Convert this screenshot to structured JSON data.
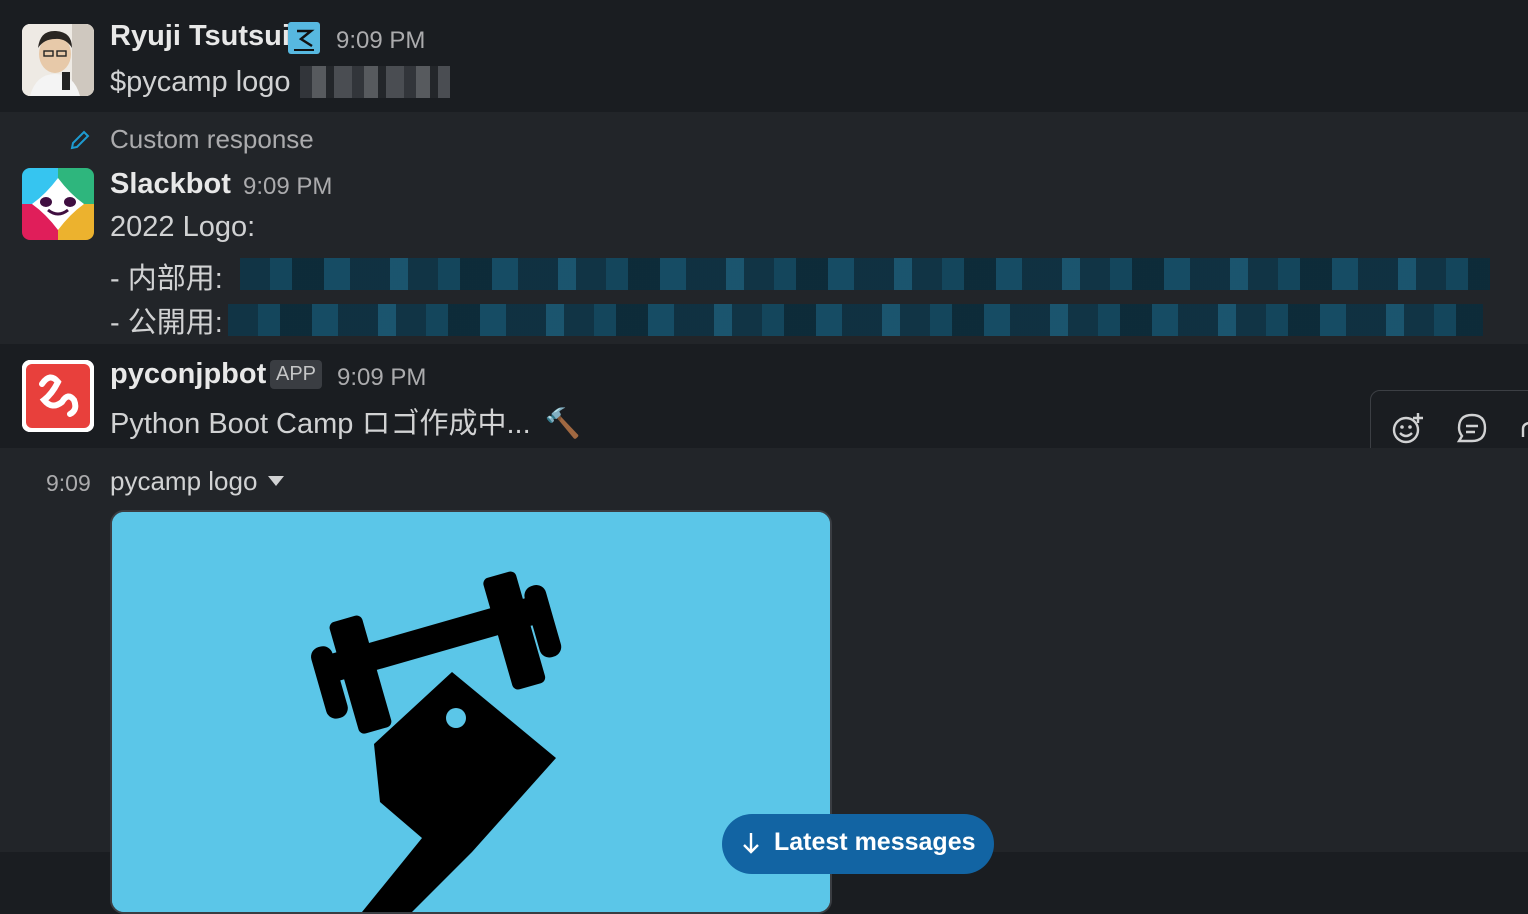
{
  "messages": [
    {
      "author": "Ryuji Tsutsui",
      "time": "9:09 PM",
      "text": "$pycamp logo"
    },
    {
      "context_label": "Custom response",
      "author": "Slackbot",
      "time": "9:09 PM",
      "lines": [
        "2022 Logo:",
        "- 内部用:",
        "- 公開用:"
      ]
    },
    {
      "author": "pyconjpbot",
      "badge": "APP",
      "time": "9:09 PM",
      "text": "Python Boot Camp ロゴ作成中...",
      "emoji": "🔨"
    }
  ],
  "file": {
    "time": "9:09",
    "name": "pycamp logo"
  },
  "actions": {
    "latest_messages": "Latest messages"
  },
  "icons": {
    "context": "pencil-icon",
    "toolbar": [
      "add-reaction-icon",
      "reply-in-thread-icon",
      "share-message-icon"
    ],
    "scroll": "arrow-down-icon"
  },
  "colors": {
    "background": "#1a1d21",
    "highlight": "#222529",
    "link_accent": "#1d9bd1",
    "button_blue": "#1264a3",
    "image_bg": "#5bc6e8"
  }
}
